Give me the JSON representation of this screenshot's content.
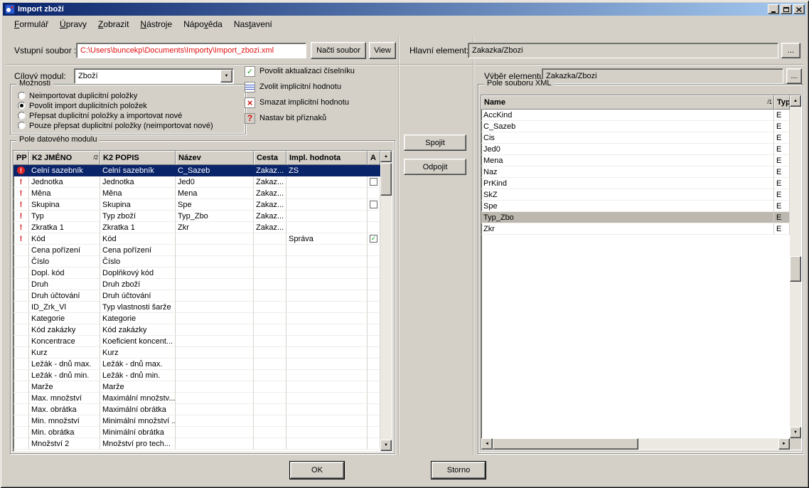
{
  "window": {
    "title": "Import zboží"
  },
  "menu": [
    {
      "label": "Formulář",
      "accel": 0
    },
    {
      "label": "Úpravy",
      "accel": 0
    },
    {
      "label": "Zobrazit",
      "accel": 0
    },
    {
      "label": "Nástroje",
      "accel": 0
    },
    {
      "label": "Nápověda",
      "accel": 4
    },
    {
      "label": "Nastavení",
      "accel": 3
    }
  ],
  "top_bar": {
    "input_file_label": "Vstupní soubor :",
    "input_file_value": "C:\\Users\\buncekp\\Documents\\Importy\\Import_zbozi.xml",
    "load_button": "Načti soubor",
    "view_button": "View",
    "main_element_label": "Hlavní element:",
    "main_element_value": "Zakazka/Zbozi",
    "browse_button": "..."
  },
  "left_panel": {
    "target_module_label": "Cílový modul:",
    "target_module_value": "Zboží",
    "options": {
      "title": "Možnosti",
      "items": [
        {
          "label": "Neimportovat duplicitní položky",
          "selected": false
        },
        {
          "label": "Povolit import duplicitních položek",
          "selected": true
        },
        {
          "label": "Přepsat duplicitní položky a importovat nové",
          "selected": false
        },
        {
          "label": "Pouze přepsat duplicitní položky (neimportovat nové)",
          "selected": false
        }
      ]
    },
    "tools": [
      {
        "icon": "check-icon",
        "label": "Povolit aktualizaci číselníku"
      },
      {
        "icon": "choose-value-icon",
        "label": "Zvolit implicitní hodnotu"
      },
      {
        "icon": "delete-icon",
        "label": "Smazat implicitní hodnotu"
      },
      {
        "icon": "flags-icon",
        "label": "Nastav bit příznaků"
      }
    ],
    "module_fields": {
      "title": "Pole datového modulu",
      "columns": [
        {
          "label": "PP"
        },
        {
          "label": "K2 JMÉNO",
          "sort": "2"
        },
        {
          "label": "K2 POPIS"
        },
        {
          "label": "Název"
        },
        {
          "label": "Cesta"
        },
        {
          "label": "Impl. hodnota"
        },
        {
          "label": "A"
        }
      ],
      "rows": [
        {
          "pp": "!",
          "k2_name": "Celní sazebník",
          "k2_desc": "Celní sazebník",
          "name": "C_Sazeb",
          "path": "Zakaz...",
          "impl": "ZS",
          "a": "",
          "selected": true
        },
        {
          "pp": "!",
          "k2_name": "Jednotka",
          "k2_desc": "Jednotka",
          "name": "Jed0",
          "path": "Zakaz...",
          "impl": "",
          "a": "unchecked",
          "selected": false
        },
        {
          "pp": "!",
          "k2_name": "Měna",
          "k2_desc": "Měna",
          "name": "Mena",
          "path": "Zakaz...",
          "impl": "",
          "a": "",
          "selected": false
        },
        {
          "pp": "!",
          "k2_name": "Skupina",
          "k2_desc": "Skupina",
          "name": "Spe",
          "path": "Zakaz...",
          "impl": "",
          "a": "unchecked",
          "selected": false
        },
        {
          "pp": "!",
          "k2_name": "Typ",
          "k2_desc": "Typ zboží",
          "name": "Typ_Zbo",
          "path": "Zakaz...",
          "impl": "",
          "a": "",
          "selected": false
        },
        {
          "pp": "!",
          "k2_name": "Zkratka 1",
          "k2_desc": "Zkratka 1",
          "name": "Zkr",
          "path": "Zakaz...",
          "impl": "",
          "a": "",
          "selected": false
        },
        {
          "pp": "!",
          "k2_name": "Kód",
          "k2_desc": "Kód",
          "name": "",
          "path": "",
          "impl": "Správa",
          "a": "checked",
          "selected": false
        },
        {
          "pp": "",
          "k2_name": "Cena pořízení",
          "k2_desc": "Cena pořízení",
          "name": "",
          "path": "",
          "impl": "",
          "a": "",
          "selected": false
        },
        {
          "pp": "",
          "k2_name": "Číslo",
          "k2_desc": "Číslo",
          "name": "",
          "path": "",
          "impl": "",
          "a": "",
          "selected": false
        },
        {
          "pp": "",
          "k2_name": "Dopl. kód",
          "k2_desc": "Doplňkový kód",
          "name": "",
          "path": "",
          "impl": "",
          "a": "",
          "selected": false
        },
        {
          "pp": "",
          "k2_name": "Druh",
          "k2_desc": "Druh zboží",
          "name": "",
          "path": "",
          "impl": "",
          "a": "",
          "selected": false
        },
        {
          "pp": "",
          "k2_name": "Druh účtování",
          "k2_desc": "Druh účtování",
          "name": "",
          "path": "",
          "impl": "",
          "a": "",
          "selected": false
        },
        {
          "pp": "",
          "k2_name": "ID_Zrk_Vl",
          "k2_desc": "Typ vlastnosti šarže",
          "name": "",
          "path": "",
          "impl": "",
          "a": "",
          "selected": false
        },
        {
          "pp": "",
          "k2_name": "Kategorie",
          "k2_desc": "Kategorie",
          "name": "",
          "path": "",
          "impl": "",
          "a": "",
          "selected": false
        },
        {
          "pp": "",
          "k2_name": "Kód zakázky",
          "k2_desc": "Kód zakázky",
          "name": "",
          "path": "",
          "impl": "",
          "a": "",
          "selected": false
        },
        {
          "pp": "",
          "k2_name": "Koncentrace",
          "k2_desc": "Koeficient koncent...",
          "name": "",
          "path": "",
          "impl": "",
          "a": "",
          "selected": false
        },
        {
          "pp": "",
          "k2_name": "Kurz",
          "k2_desc": "Kurz",
          "name": "",
          "path": "",
          "impl": "",
          "a": "",
          "selected": false
        },
        {
          "pp": "",
          "k2_name": "Ležák - dnů max.",
          "k2_desc": "Ležák - dnů max.",
          "name": "",
          "path": "",
          "impl": "",
          "a": "",
          "selected": false
        },
        {
          "pp": "",
          "k2_name": "Ležák - dnů min.",
          "k2_desc": "Ležák - dnů min.",
          "name": "",
          "path": "",
          "impl": "",
          "a": "",
          "selected": false
        },
        {
          "pp": "",
          "k2_name": "Marže",
          "k2_desc": "Marže",
          "name": "",
          "path": "",
          "impl": "",
          "a": "",
          "selected": false
        },
        {
          "pp": "",
          "k2_name": "Max. množství",
          "k2_desc": "Maximální množstv...",
          "name": "",
          "path": "",
          "impl": "",
          "a": "",
          "selected": false
        },
        {
          "pp": "",
          "k2_name": "Max. obrátka",
          "k2_desc": "Maximální obrátka",
          "name": "",
          "path": "",
          "impl": "",
          "a": "",
          "selected": false
        },
        {
          "pp": "",
          "k2_name": "Min. množství",
          "k2_desc": "Minimální množství ...",
          "name": "",
          "path": "",
          "impl": "",
          "a": "",
          "selected": false
        },
        {
          "pp": "",
          "k2_name": "Min. obrátka",
          "k2_desc": "Minimální obrátka",
          "name": "",
          "path": "",
          "impl": "",
          "a": "",
          "selected": false
        },
        {
          "pp": "",
          "k2_name": "Množství 2",
          "k2_desc": "Množství pro tech...",
          "name": "",
          "path": "",
          "impl": "",
          "a": "",
          "selected": false
        }
      ]
    }
  },
  "middle": {
    "connect": "Spojit",
    "disconnect": "Odpojit"
  },
  "right_panel": {
    "element_label": "Výběr elementu:",
    "element_value": "Zakazka/Zbozi",
    "browse_button": "...",
    "xml_fields": {
      "title": "Pole souboru XML",
      "columns": [
        {
          "label": "Name",
          "sort": "1"
        },
        {
          "label": "Typ"
        }
      ],
      "rows": [
        {
          "name": "AccKind",
          "typ": "E",
          "selected": false
        },
        {
          "name": "C_Sazeb",
          "typ": "E",
          "selected": false
        },
        {
          "name": "Cis",
          "typ": "E",
          "selected": false
        },
        {
          "name": "Jed0",
          "typ": "E",
          "selected": false
        },
        {
          "name": "Mena",
          "typ": "E",
          "selected": false
        },
        {
          "name": "Naz",
          "typ": "E",
          "selected": false
        },
        {
          "name": "PrKind",
          "typ": "E",
          "selected": false
        },
        {
          "name": "SkZ",
          "typ": "E",
          "selected": false
        },
        {
          "name": "Spe",
          "typ": "E",
          "selected": false
        },
        {
          "name": "Typ_Zbo",
          "typ": "E",
          "selected": true
        },
        {
          "name": "Zkr",
          "typ": "E",
          "selected": false
        }
      ]
    }
  },
  "footer": {
    "ok": "OK",
    "cancel": "Storno"
  },
  "colors": {
    "face": "#d4d0c8",
    "titlebar_left": "#0a246a",
    "titlebar_right": "#a6caf0",
    "selection": "#0a246a",
    "file_path_red": "#e01010",
    "inactive_selection": "#bcb8af",
    "check_green": "#16a016",
    "alert_red": "#cc1111"
  }
}
